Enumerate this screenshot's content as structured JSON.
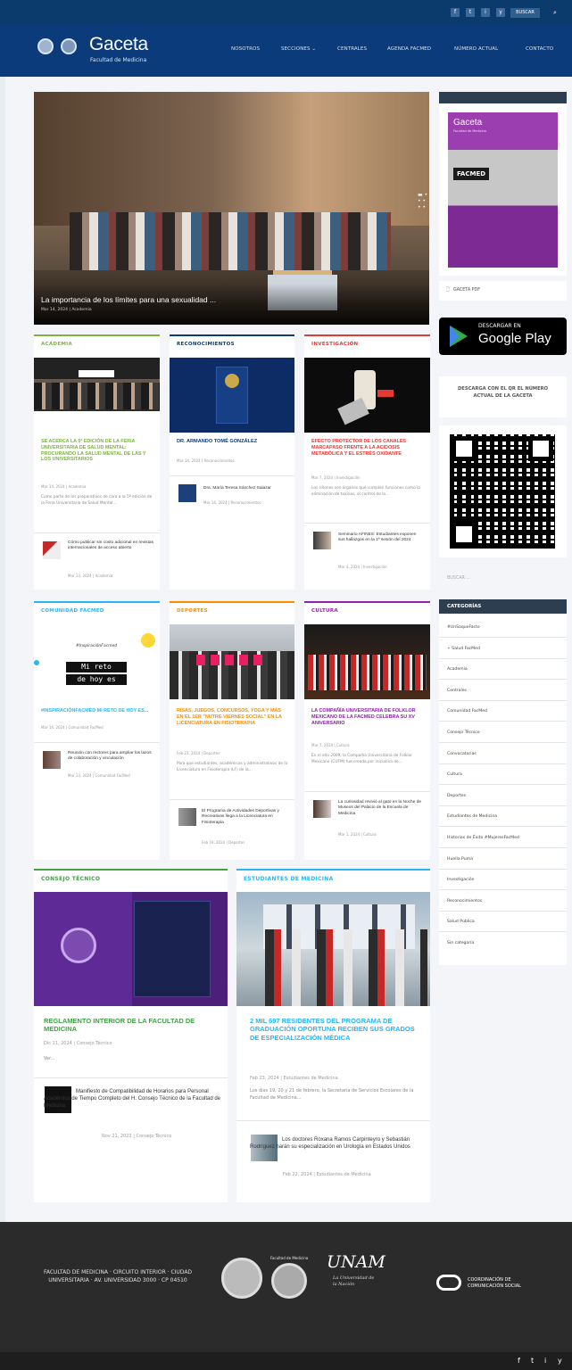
{
  "topbar": {
    "social": [
      "f",
      "t",
      "i",
      "y"
    ],
    "search_label": "BUSCAR",
    "search_icon": "search-icon"
  },
  "header": {
    "logo_title": "Gaceta",
    "logo_sub": "Facultad de Medicina",
    "nav": [
      "NOSOTROS",
      "SECCIONES ⌄",
      "CENTRALES",
      "AGENDA FACMED",
      "NÚMERO ACTUAL",
      "CONTACTO"
    ]
  },
  "hero": {
    "title": "La importancia de los límites para una sexualidad ...",
    "meta": "Mar 14, 2024 | Academia"
  },
  "cards": {
    "academia": {
      "cat": "ACADEMIA",
      "color": "#7cb342",
      "title": "SE ACERCA LA 5ª EDICIÓN DE LA FERIA UNIVERSITARIA DE SALUD MENTAL: PROCURANDO LA SALUD MENTAL DE LAS Y LOS UNIVERSITARIOS",
      "meta": "Mar 14, 2024 | Academia",
      "excerpt": "Como parte de los preparativos de cara a la 5ª edición de la Feria Universitaria de Salud Mental...",
      "small_title": "Cómo publicar sin costo adicional en revistas internacionales de acceso abierto",
      "small_meta": "Mar 13, 2024 | Academia"
    },
    "reconocimientos": {
      "cat": "RECONOCIMIENTOS",
      "color": "#0b3b7a",
      "title": "DR. ARMANDO TOMÉ GONZÁLEZ",
      "meta": "Mar 14, 2024 | Reconocimientos",
      "small_title": "Dra. María Teresa Sánchez Salazar",
      "small_meta": "Mar 14, 2024 | Reconocimientos"
    },
    "investigacion": {
      "cat": "INVESTIGACIÓN",
      "color": "#e53935",
      "title": "EFECTO PROTECTOR DE LOS CANALES MARCAPASO FRENTE A LA ACIDOSIS METABÓLICA Y EL ESTRÉS OXIDANTE",
      "meta": "Mar 7, 2024 | Investigación",
      "excerpt": "Los riñones son órganos que cumplen funciones como la eliminación de toxinas, el control de la...",
      "small_title": "Seminario AFINES: Estudiantes exponen sus hallazgos en la 1ª sesión del 2024",
      "small_meta": "Mar 4, 2024 | Investigación"
    },
    "comunidad": {
      "cat": "COMUNIDAD FACMED",
      "color": "#29b6f6",
      "title": "#INSPIRACIÓNFACMED MI RETO DE HOY ES...",
      "meta": "Mar 14, 2024 | Comunidad FacMed",
      "img_tag": "#InspiraciónFacmed",
      "img_line1": "Mi reto",
      "img_line2": "de hoy es",
      "small_title": "Reunión con rectores para ampliar los lazos de colaboración y vinculación",
      "small_meta": "Mar 13, 2024 | Comunidad FacMed"
    },
    "deportes": {
      "cat": "DEPORTES",
      "color": "#fb8c00",
      "title": "RISAS, JUEGOS, CONCURSOS, YOGA Y MÁS EN EL 1ER \"NUTRE-VIERNES SOCIAL\" EN LA LICENCIATURA EN FISIOTERAPIA",
      "meta": "Feb 23, 2024 | Deportes",
      "excerpt": "Para que estudiantes, académicos y administrativos de la Licenciatura en Fisioterapia (LF) de la...",
      "small_title": "El Programa de Actividades Deportivas y Recreativas llega a la Licenciatura en Fisioterapia",
      "small_meta": "Feb 19, 2024 | Deportes"
    },
    "cultura": {
      "cat": "CULTURA",
      "color": "#8e24aa",
      "title": "LA COMPAÑÍA UNIVERSITARIA DE FOLKLOR MEXICANO DE LA FACMED CELEBRA SU XV ANIVERSARIO",
      "meta": "Mar 7, 2024 | Cultura",
      "excerpt": "En el año 2009, la Compañía Universitaria de Folklor Mexicano (CUFM) fue creada por iniciativa de...",
      "small_title": "La curiosidad revivió al gato en la Noche de Museos del Palacio de la Escuela de Medicina",
      "small_meta": "Mar 1, 2024 | Cultura"
    },
    "consejo": {
      "cat": "CONSEJO TÉCNICO",
      "color": "#43a047",
      "title": "REGLAMENTO INTERIOR DE LA FACULTAD DE MEDICINA",
      "meta": "Dic 11, 2024 | Consejo Técnico",
      "excerpt": "Ver...",
      "small_title": "Manifiesto de Compatibilidad de Horarios para Personal Académico de Tiempo Completo del H. Consejo Técnico de la Facultad de Medicina",
      "small_meta": "Nov 21, 2023 | Consejo Técnico"
    },
    "estudiantes": {
      "cat": "ESTUDIANTES DE MEDICINA",
      "color": "#29b6f6",
      "title": "2 MIL 697 RESIDENTES DEL PROGRAMA DE GRADUACIÓN OPORTUNA RECIBEN SUS GRADOS DE ESPECIALIZACIÓN MÉDICA",
      "meta": "Feb 23, 2024 | Estudiantes de Medicina",
      "excerpt": "Los días 19, 20 y 21 de febrero, la Secretaría de Servicios Escolares de la Facultad de Medicina...",
      "small_title": "Los doctores Roxana Ramos Carpinteyro y Sebastián Rodríguez harán su especialización en Urología en Estados Unidos",
      "small_meta": "Feb 22, 2024 | Estudiantes de Medicina"
    }
  },
  "sidebar": {
    "cover_title": "Gaceta",
    "cover_sub": "Facultad de Medicina",
    "cover_badge": "FACMED",
    "pdf_label": "GACETA PDF",
    "gp_small": "DESCARGAR EN",
    "gp_big": "Google Play",
    "qr_text": "DESCARGA CON EL QR EL NÚMERO ACTUAL DE LA GACETA",
    "search_placeholder": "BUSCAR ...",
    "categories_title": "CATEGORÍAS",
    "categories": [
      "#UnSaqueFacto",
      "+ Salud FacMed",
      "Academia",
      "Centrales",
      "Comunidad FacMed",
      "Consejo Técnico",
      "Convocatorias",
      "Cultura",
      "Deportes",
      "Estudiantes de Medicina",
      "Historias de Éxito #MujeresFacMed",
      "Huella Puma",
      "Investigación",
      "Reconocimientos",
      "Salud Pública",
      "Sin categoría"
    ]
  },
  "footer": {
    "address": "FACULTAD DE MEDICINA · CIRCUITO INTERIOR · CIUDAD UNIVERSITARIA · AV. UNIVERSIDAD 3000 · CP 04510",
    "facmed_label": "Facultad de Medicina",
    "unam_label": "UNAM",
    "unam_sub": "La Universidad de la Nación",
    "coord": "COORDINACIÓN DE COMUNICACIÓN SOCIAL",
    "bottom_social": [
      "f",
      "t",
      "i",
      "y"
    ]
  }
}
